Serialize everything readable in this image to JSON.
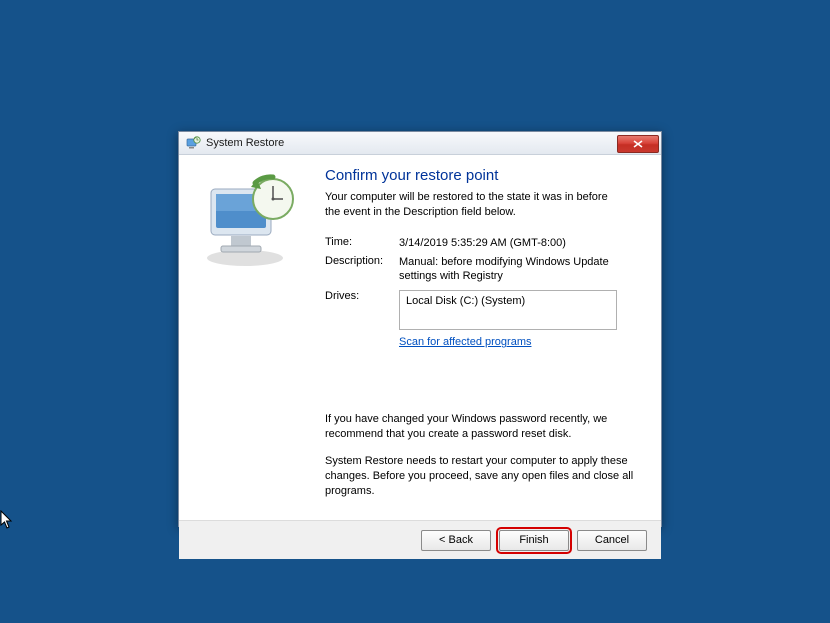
{
  "window": {
    "title": "System Restore"
  },
  "heading": "Confirm your restore point",
  "subtext": "Your computer will be restored to the state it was in before the event in the Description field below.",
  "fields": {
    "time_label": "Time:",
    "time_value": "3/14/2019 5:35:29 AM (GMT-8:00)",
    "desc_label": "Description:",
    "desc_value": "Manual: before modifying Windows Update settings with Registry",
    "drives_label": "Drives:",
    "drives_value": "Local Disk (C:) (System)"
  },
  "scan_link": "Scan for affected programs",
  "note1": "If you have changed your Windows password recently, we recommend that you create a password reset disk.",
  "note2": "System Restore needs to restart your computer to apply these changes. Before you proceed, save any open files and close all programs.",
  "buttons": {
    "back": "< Back",
    "finish": "Finish",
    "cancel": "Cancel"
  }
}
